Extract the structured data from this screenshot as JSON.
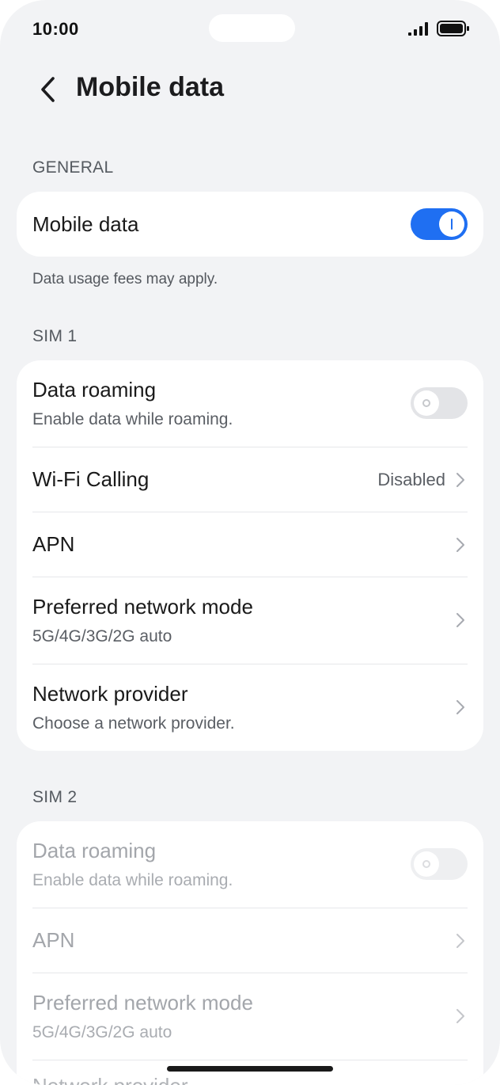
{
  "status_bar": {
    "time": "10:00",
    "icons": [
      "signal-icon",
      "battery-icon"
    ]
  },
  "header": {
    "back_icon": "chevron-left-icon",
    "title": "Mobile data"
  },
  "general": {
    "label": "GENERAL",
    "mobile_data": {
      "title": "Mobile data",
      "enabled": true
    },
    "note": "Data usage fees may apply."
  },
  "sim1": {
    "label": "SIM 1",
    "data_roaming": {
      "title": "Data roaming",
      "subtitle": "Enable data while roaming.",
      "enabled": false
    },
    "wifi_calling": {
      "title": "Wi-Fi Calling",
      "value": "Disabled"
    },
    "apn": {
      "title": "APN"
    },
    "preferred_network_mode": {
      "title": "Preferred network mode",
      "subtitle": "5G/4G/3G/2G auto"
    },
    "network_provider": {
      "title": "Network provider",
      "subtitle": "Choose a network provider."
    }
  },
  "sim2": {
    "label": "SIM 2",
    "data_roaming": {
      "title": "Data roaming",
      "subtitle": "Enable data while roaming.",
      "enabled": false
    },
    "apn": {
      "title": "APN"
    },
    "preferred_network_mode": {
      "title": "Preferred network mode",
      "subtitle": "5G/4G/3G/2G auto"
    },
    "network_provider_peek": "Network provider"
  },
  "colors": {
    "accent": "#1f6ff2",
    "background": "#f2f3f5",
    "card": "#ffffff"
  }
}
